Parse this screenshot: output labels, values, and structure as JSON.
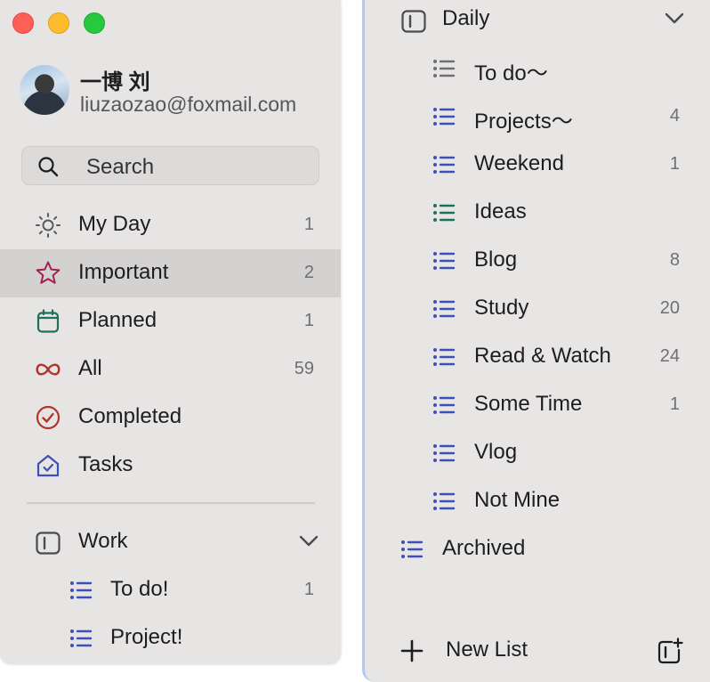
{
  "window": {
    "controls": [
      "close",
      "minimize",
      "zoom"
    ]
  },
  "user": {
    "name": "一博 刘",
    "email": "liuzaozao@foxmail.com"
  },
  "search": {
    "placeholder": "Search"
  },
  "smart_lists": [
    {
      "label": "My Day",
      "icon": "sun-icon",
      "count": "1",
      "color": "#5b5b5f"
    },
    {
      "label": "Important",
      "icon": "star-icon",
      "count": "2",
      "color": "#a3214f",
      "selected": true
    },
    {
      "label": "Planned",
      "icon": "calendar-icon",
      "count": "1",
      "color": "#1f6f5a"
    },
    {
      "label": "All",
      "icon": "infinity-icon",
      "count": "59",
      "color": "#b1342a"
    },
    {
      "label": "Completed",
      "icon": "check-circle-icon",
      "count": "",
      "color": "#b1342a"
    },
    {
      "label": "Tasks",
      "icon": "home-icon",
      "count": "",
      "color": "#3f4fb8"
    }
  ],
  "left_group": {
    "label": "Work",
    "icon": "group-icon",
    "items": [
      {
        "label": "To do!",
        "count": "1"
      },
      {
        "label": "Project!",
        "count": ""
      }
    ]
  },
  "right_group": {
    "label": "Daily",
    "icon": "group-icon",
    "items": [
      {
        "label": "To do～",
        "count": "",
        "color": "#6e6e73"
      },
      {
        "label": "Projects～",
        "count": "4",
        "color": "#3f4fb8"
      },
      {
        "label": "Weekend",
        "count": "1",
        "color": "#3f4fb8"
      },
      {
        "label": "Ideas",
        "count": "",
        "color": "#1f6f5a"
      },
      {
        "label": "Blog",
        "count": "8",
        "color": "#3f4fb8"
      },
      {
        "label": "Study",
        "count": "20",
        "color": "#3f4fb8"
      },
      {
        "label": "Read & Watch",
        "count": "24",
        "color": "#3f4fb8"
      },
      {
        "label": "Some Time",
        "count": "1",
        "color": "#3f4fb8"
      },
      {
        "label": "Vlog",
        "count": "",
        "color": "#3f4fb8"
      },
      {
        "label": "Not Mine",
        "count": "",
        "color": "#3f4fb8"
      }
    ]
  },
  "archived": {
    "label": "Archived",
    "color": "#3f4fb8"
  },
  "footer": {
    "new_list_label": "New List",
    "new_group_icon": "new-group-icon"
  },
  "colors": {
    "sidebar_bg": "#e7e5e4",
    "selected_bg": "#d4d2d1",
    "list_accent": "#3f4fb8",
    "focus_border": "#a9cdf2"
  }
}
